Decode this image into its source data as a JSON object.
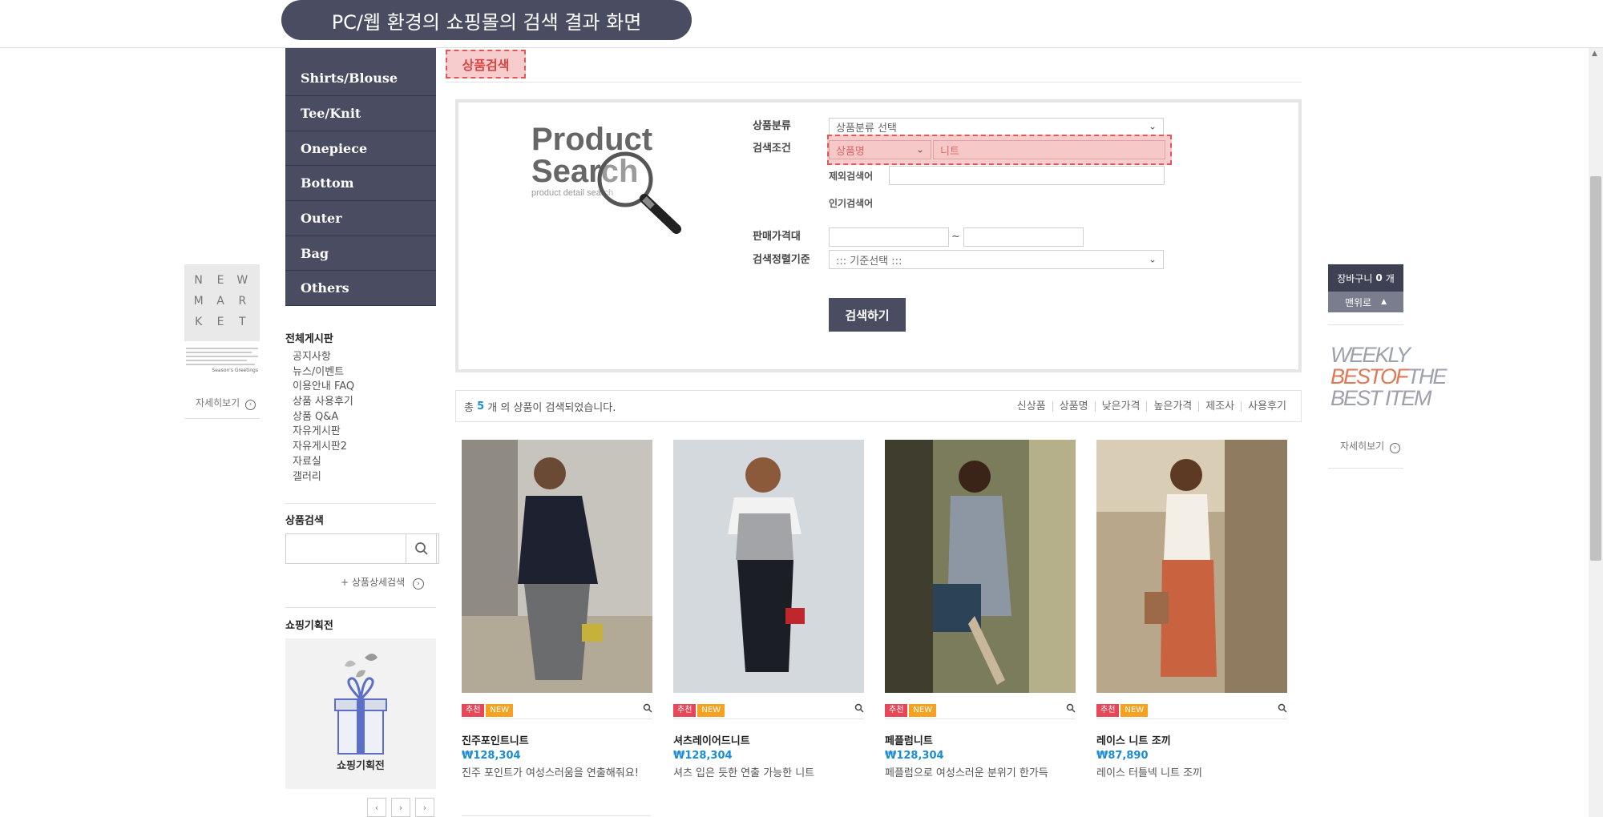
{
  "banner": {
    "title": "PC/웹 환경의 쇼핑몰의 검색 결과 화면"
  },
  "categories": [
    "Shirts/Blouse",
    "Tee/Knit",
    "Onepiece",
    "Bottom",
    "Outer",
    "Bag",
    "Others"
  ],
  "board": {
    "title": "전체게시판",
    "items": [
      "공지사항",
      "뉴스/이벤트",
      "이용안내 FAQ",
      "상품 사용후기",
      "상품 Q&A",
      "자유게시판",
      "자유게시판2",
      "자료실",
      "갤러리"
    ]
  },
  "side_search": {
    "title": "상품검색",
    "advanced_link": "+ 상품상세검색"
  },
  "plan": {
    "title": "쇼핑기획전",
    "box_label": "쇼핑기획전",
    "prev": "‹",
    "next": "›",
    "last": "›"
  },
  "new_market": {
    "letters": [
      "N",
      "E",
      "W",
      "M",
      "A",
      "R",
      "K",
      "E",
      "T"
    ],
    "caption": "Season's Greetings",
    "detail_link": "자세히보기"
  },
  "page_tab": "상품검색",
  "search_panel": {
    "logo_line1": "Product",
    "logo_line2": "Search",
    "logo_sub": "product detail search",
    "category_label": "상품분류",
    "category_value": "상품분류 선택",
    "condition_label": "검색조건",
    "condition_value": "상품명",
    "condition_input": "니트",
    "exclude_label": "제외검색어",
    "popular_label": "인기검색어",
    "price_label": "판매가격대",
    "price_sep": "~",
    "sort_label": "검색정렬기준",
    "sort_value": "::: 기준선택 :::",
    "submit": "검색하기"
  },
  "results": {
    "prefix": "총",
    "count": "5",
    "suffix": "개 의 상품이 검색되었습니다.",
    "sort_options": [
      "신상품",
      "상품명",
      "낮은가격",
      "높은가격",
      "제조사",
      "사용후기"
    ]
  },
  "badges": {
    "recommend": "추천",
    "new": "NEW"
  },
  "products": [
    {
      "name": "진주포인트니트",
      "price": "₩128,304",
      "desc": "진주 포인트가 여성스러움을 연출해줘요!"
    },
    {
      "name": "셔츠레이어드니트",
      "price": "₩128,304",
      "desc": "셔츠 입은 듯한 연출 가능한 니트"
    },
    {
      "name": "페플럼니트",
      "price": "₩128,304",
      "desc": "페플럼으로 여성스러운 분위기 한가득"
    },
    {
      "name": "레이스 니트 조끼",
      "price": "₩87,890",
      "desc": "레이스 터틀넥 니트 조끼"
    }
  ],
  "cart": {
    "label": "장바구니",
    "count": "0",
    "unit": "개",
    "top_button": "맨위로"
  },
  "weekly": {
    "line1": "WEEKLY",
    "line2a": "BEST",
    "line2b": "OF",
    "line2c": "THE",
    "line3": "BEST ITEM",
    "detail_link": "자세히보기"
  },
  "colors": {
    "accent": "#4a4d61",
    "highlight": "#f7cccc",
    "price": "#1a8bd6",
    "badge_red": "#e8475a",
    "badge_orange": "#f6a21e"
  }
}
